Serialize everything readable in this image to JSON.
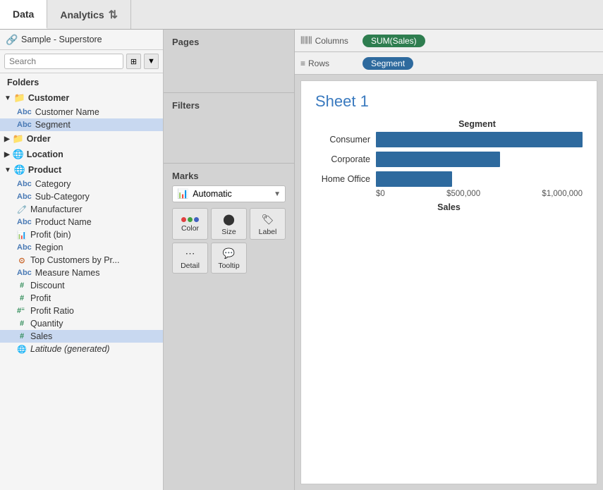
{
  "tabs": {
    "data_label": "Data",
    "analytics_label": "Analytics"
  },
  "datasource": {
    "label": "Sample - Superstore"
  },
  "search": {
    "placeholder": "Search"
  },
  "folders_label": "Folders",
  "fields": {
    "customer_group": {
      "label": "Customer",
      "expanded": true,
      "items": [
        {
          "name": "Customer Name",
          "type": "abc"
        },
        {
          "name": "Segment",
          "type": "abc",
          "selected": true
        }
      ]
    },
    "order_group": {
      "label": "Order",
      "expanded": false,
      "items": []
    },
    "location_group": {
      "label": "Location",
      "expanded": false,
      "items": []
    },
    "product_group": {
      "label": "Product",
      "expanded": true,
      "items": [
        {
          "name": "Category",
          "type": "abc"
        },
        {
          "name": "Sub-Category",
          "type": "abc"
        },
        {
          "name": "Manufacturer",
          "type": "geo"
        },
        {
          "name": "Product Name",
          "type": "abc"
        }
      ]
    },
    "standalone_items": [
      {
        "name": "Profit (bin)",
        "type": "num",
        "icon": "bar"
      },
      {
        "name": "Region",
        "type": "abc"
      },
      {
        "name": "Top Customers by Pr...",
        "type": "set"
      },
      {
        "name": "Measure Names",
        "type": "abc"
      },
      {
        "name": "Discount",
        "type": "hash"
      },
      {
        "name": "Profit",
        "type": "hash"
      },
      {
        "name": "Profit Ratio",
        "type": "hash-calc"
      },
      {
        "name": "Quantity",
        "type": "hash"
      },
      {
        "name": "Sales",
        "type": "hash",
        "selected": true
      },
      {
        "name": "Latitude (generated)",
        "type": "geo-italic"
      }
    ]
  },
  "pages_label": "Pages",
  "filters_label": "Filters",
  "marks_label": "Marks",
  "marks_dropdown": {
    "icon": "bar-chart",
    "label": "Automatic"
  },
  "marks_buttons": [
    {
      "name": "Color",
      "key": "color"
    },
    {
      "name": "Size",
      "key": "size"
    },
    {
      "name": "Label",
      "key": "label"
    },
    {
      "name": "Detail",
      "key": "detail"
    },
    {
      "name": "Tooltip",
      "key": "tooltip"
    }
  ],
  "columns_label": "Columns",
  "rows_label": "Rows",
  "columns_pill": "SUM(Sales)",
  "rows_pill": "Segment",
  "chart": {
    "title": "Sheet 1",
    "x_axis_label": "Sales",
    "segment_label": "Segment",
    "bars": [
      {
        "label": "Consumer",
        "value": 1161773,
        "pct": 100
      },
      {
        "label": "Corporate",
        "value": 706146,
        "pct": 60
      },
      {
        "label": "Home Office",
        "value": 429653,
        "pct": 37
      }
    ],
    "x_ticks": [
      "$0",
      "$500,000",
      "$1,000,000"
    ]
  }
}
